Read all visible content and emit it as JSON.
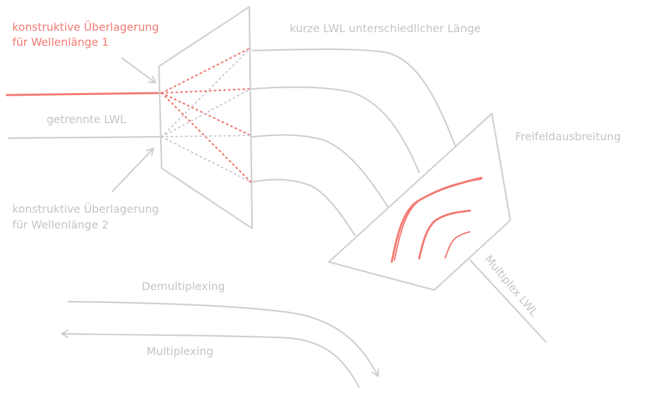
{
  "labels": {
    "constructive_1_line1": "konstruktive Überlagerung",
    "constructive_1_line2": "für Wellenlänge 1",
    "short_fibers": "kurze LWL unterschiedlicher Länge",
    "separated_fibers": "getrennte LWL",
    "free_field": "Freifeldausbreitung",
    "constructive_2_line1": "konstruktive Überlagerung",
    "constructive_2_line2": "für Wellenlänge 2",
    "multiplex_fiber": "Multiplex LWL",
    "demultiplexing": "Demultiplexing",
    "multiplexing": "Multiplexing"
  },
  "colors": {
    "accent_red": "#f27a73",
    "line_grey": "#cfcfcf",
    "text_grey": "#c4c4c4"
  }
}
